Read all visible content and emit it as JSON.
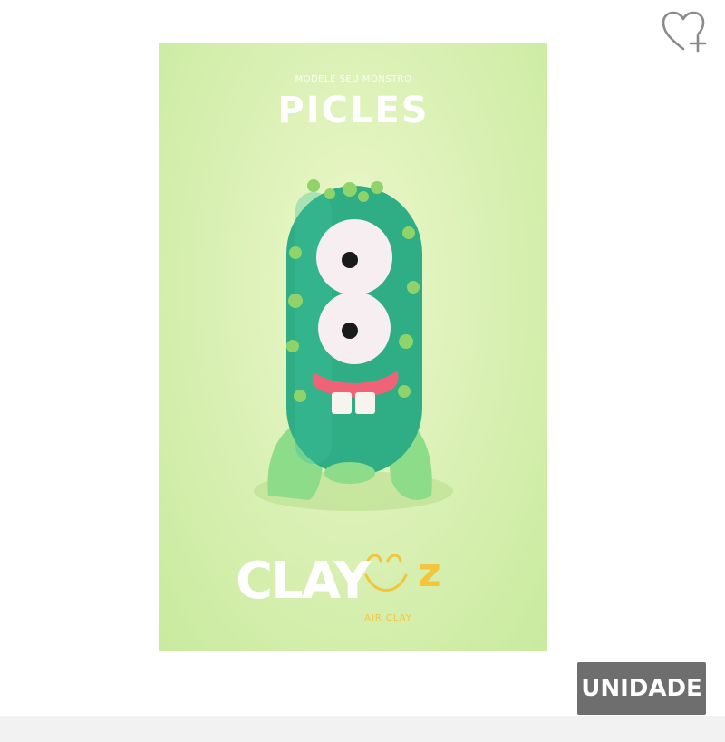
{
  "product": {
    "kicker": "MODELE SEU MONSTRO",
    "title": "PICLES",
    "brand": "CLAY",
    "brand_sub": "AIR CLAY"
  },
  "badge": {
    "label": "UNIDADE"
  },
  "favorite": {
    "icon": "heart-plus-icon"
  },
  "colors": {
    "background": "#cfeba3",
    "monster_body": "#2fae86",
    "monster_spots": "#8fd36a",
    "mouth": "#f06377",
    "badge": "#6e6e6e",
    "brand_accent": "#f2c53d"
  }
}
